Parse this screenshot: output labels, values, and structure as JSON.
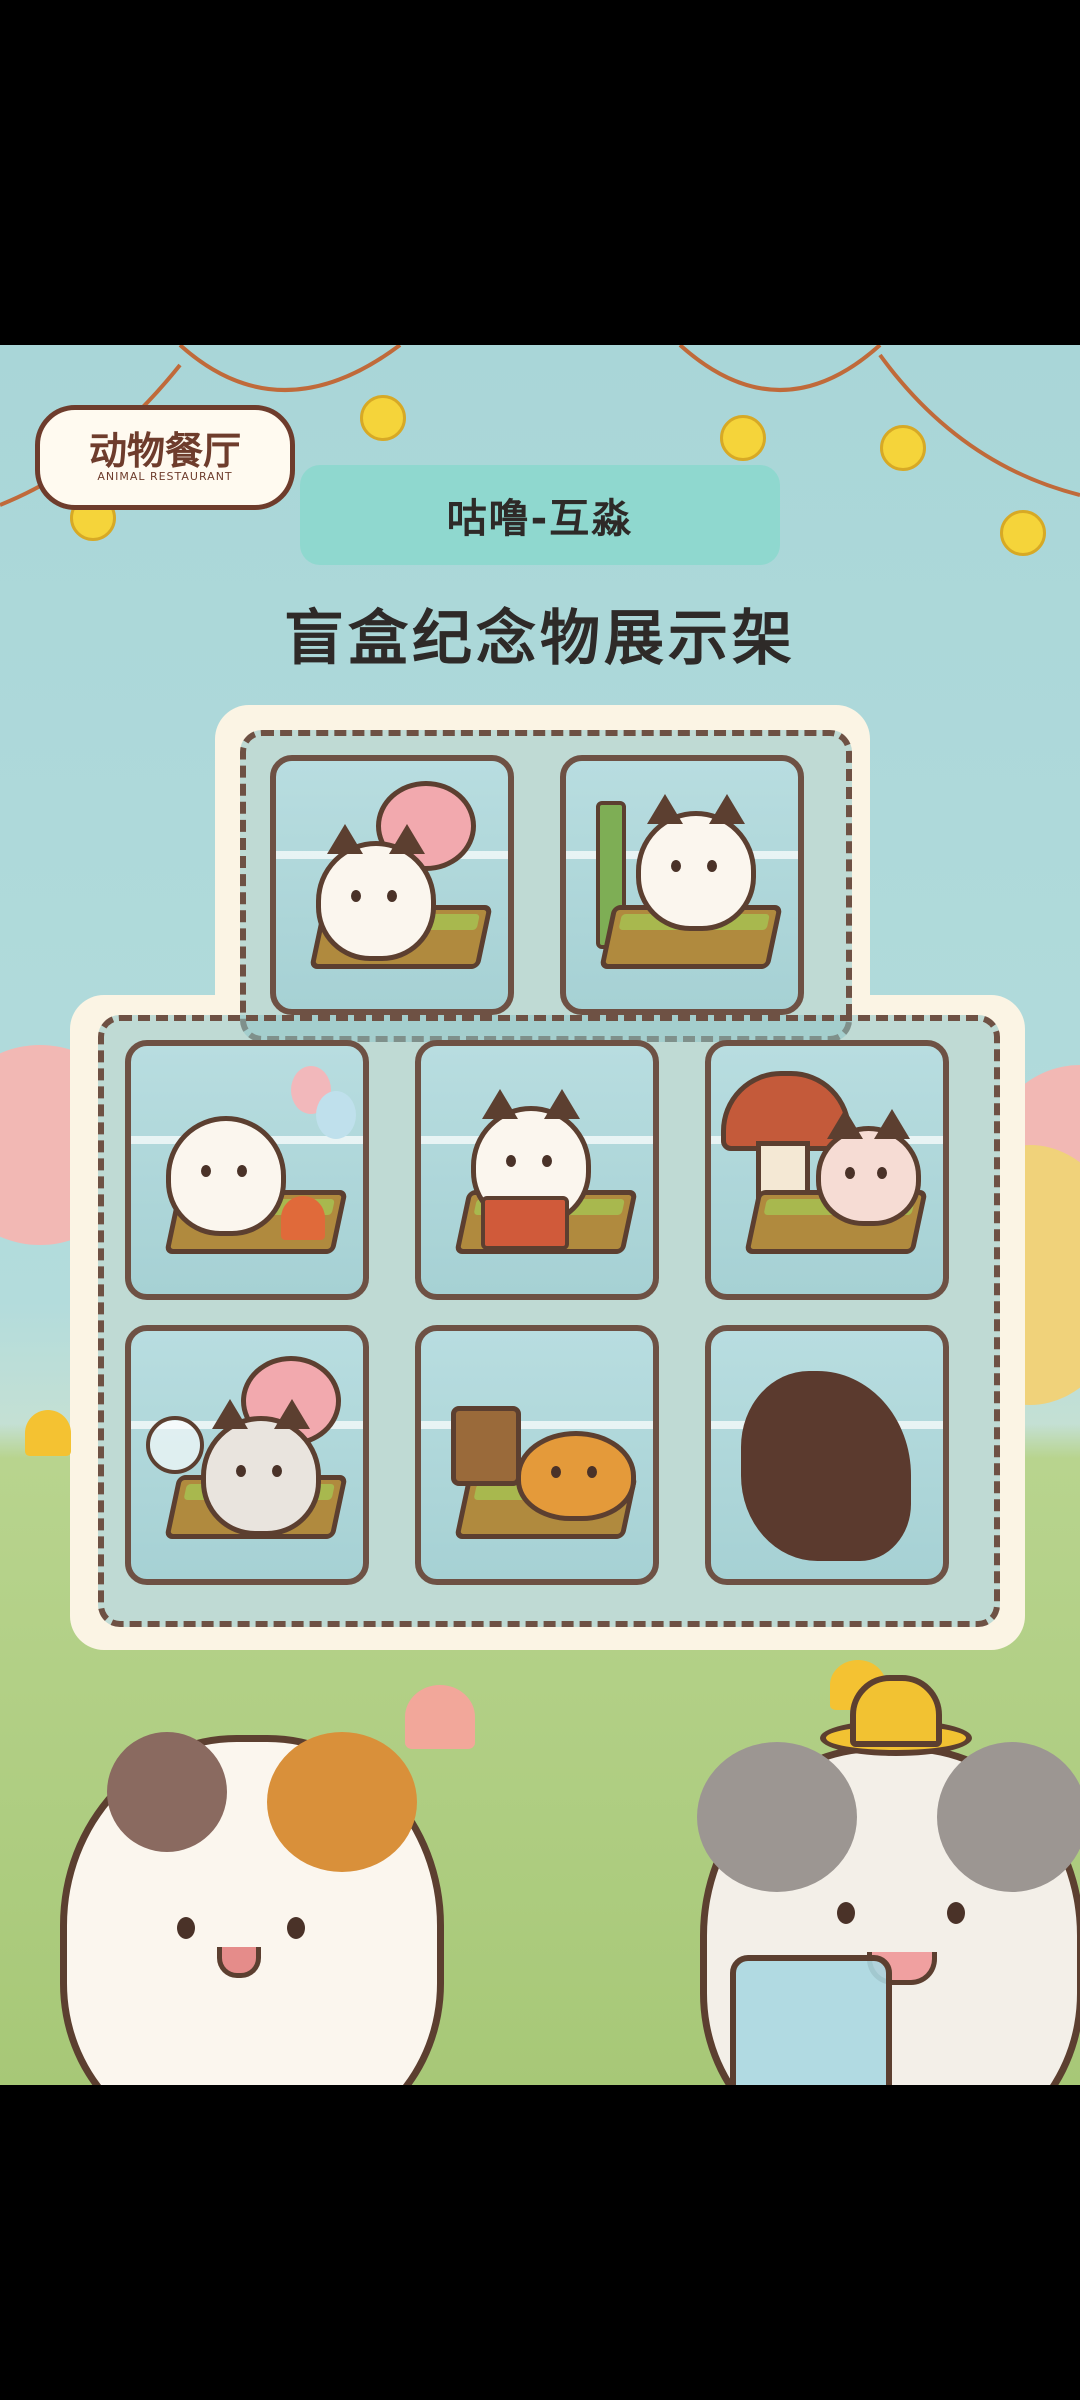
{
  "app": {
    "logo_text": "动物餐厅",
    "logo_subtext": "ANIMAL RESTAURANT"
  },
  "banner": {
    "username": "咕噜-互淼"
  },
  "page": {
    "title": "盲盒纪念物展示架"
  },
  "shelf": {
    "cells": [
      {
        "name": "calico-cat-pink-tree",
        "unlocked": true
      },
      {
        "name": "cow-cat-bamboo-bath",
        "unlocked": true
      },
      {
        "name": "owl-campfire-balloons",
        "unlocked": true
      },
      {
        "name": "grey-cat-accordion",
        "unlocked": true
      },
      {
        "name": "fox-mushroom-house",
        "unlocked": true
      },
      {
        "name": "tabby-cat-butterfly-net",
        "unlocked": true
      },
      {
        "name": "orange-dog-flower-crown",
        "unlocked": true
      },
      {
        "name": "locked-silhouette",
        "unlocked": false
      }
    ]
  },
  "colors": {
    "sky": "#a9d6d8",
    "grass": "#a7c877",
    "outline": "#6e5144",
    "banner": "#8fd8cf",
    "bulb": "#f5d43a"
  }
}
